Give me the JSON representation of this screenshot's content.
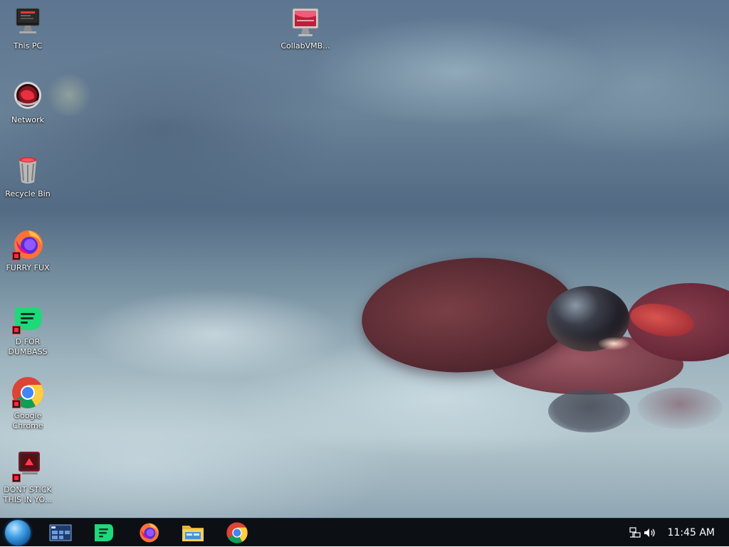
{
  "desktop": {
    "icons": [
      {
        "label": "This PC"
      },
      {
        "label": "Network"
      },
      {
        "label": "Recycle Bin"
      },
      {
        "label": "FURRY FUX"
      },
      {
        "label": "D FOR DUMBASS"
      },
      {
        "label": "Google Chrome"
      },
      {
        "label": "DONT STICK THIS IN YO..."
      },
      {
        "label": "CollabVMB..."
      }
    ]
  },
  "taskbar": {
    "pinned": [
      {
        "icon": "start-orb-icon"
      },
      {
        "icon": "task-view-icon"
      },
      {
        "icon": "messaging-app-icon"
      },
      {
        "icon": "firefox-icon"
      },
      {
        "icon": "file-explorer-icon"
      },
      {
        "icon": "chrome-icon"
      }
    ],
    "tray": {
      "time": "11:45 AM"
    }
  },
  "colors": {
    "taskbar_bg": "#0c1015",
    "shortcut_badge": "#ff2a3a"
  }
}
